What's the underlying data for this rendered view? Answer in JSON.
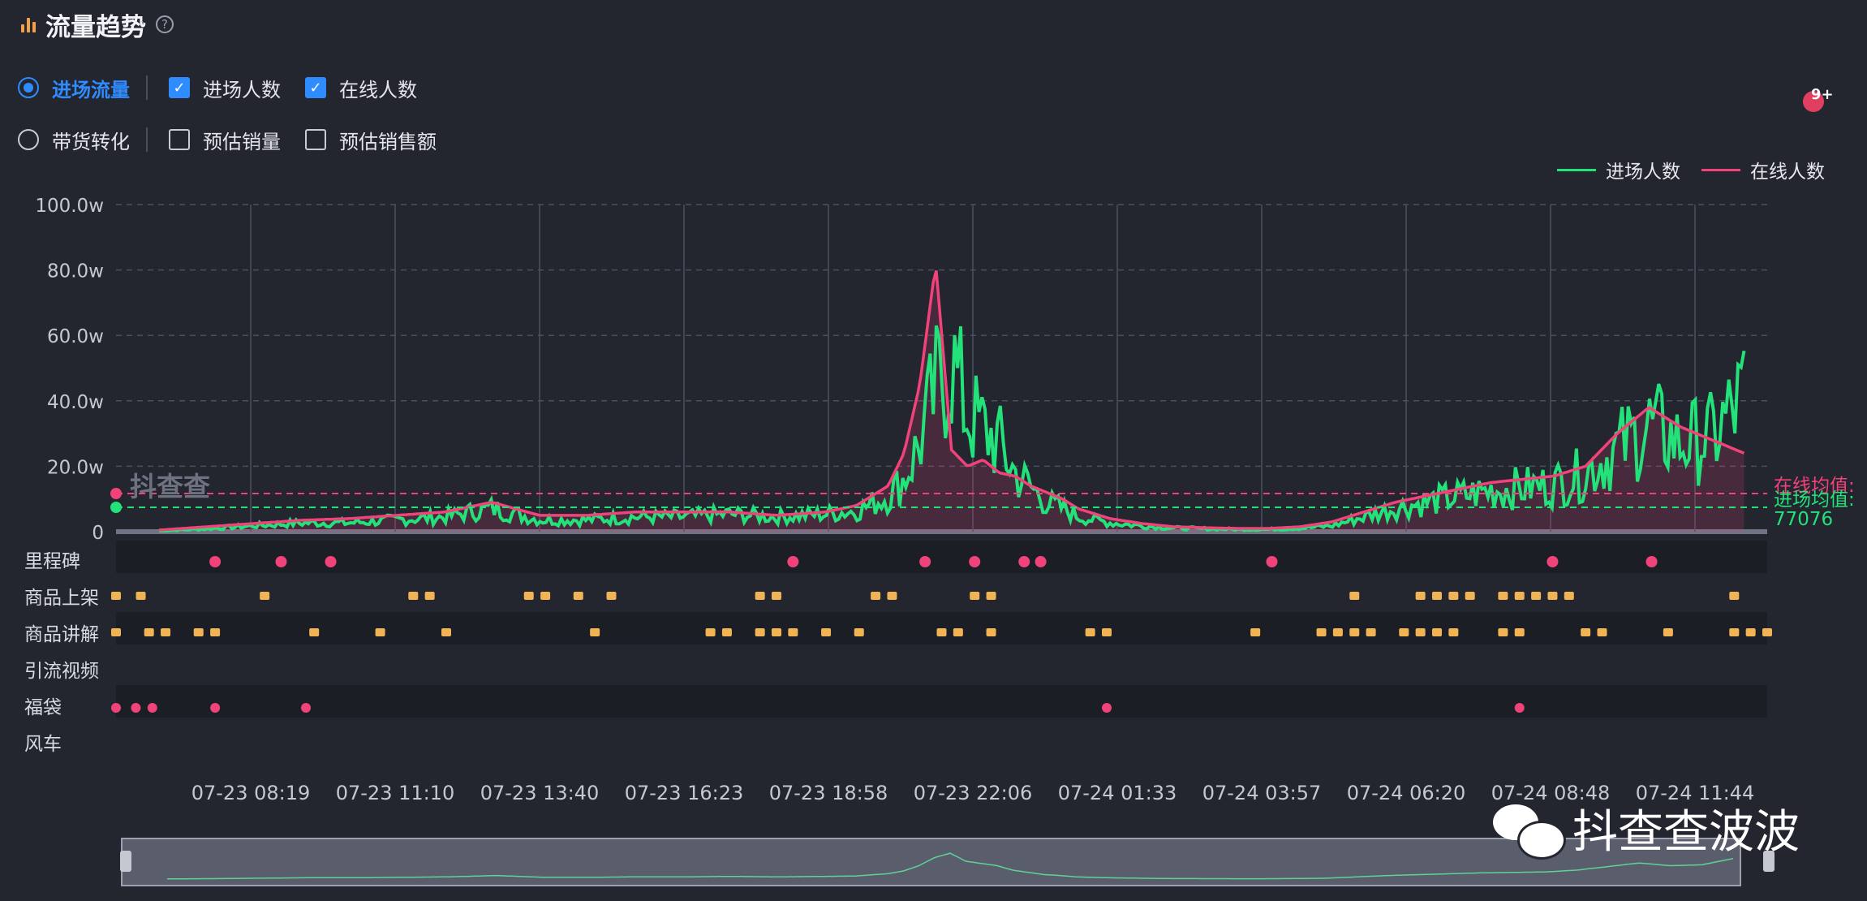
{
  "header": {
    "title": "流量趋势",
    "help_icon": "?"
  },
  "options": {
    "row1": [
      {
        "type": "radio",
        "label": "进场流量",
        "checked": true
      },
      {
        "type": "checkbox",
        "label": "进场人数",
        "checked": true
      },
      {
        "type": "checkbox",
        "label": "在线人数",
        "checked": true
      }
    ],
    "row2": [
      {
        "type": "radio",
        "label": "带货转化",
        "checked": false
      },
      {
        "type": "checkbox",
        "label": "预估销量",
        "checked": false
      },
      {
        "type": "checkbox",
        "label": "预估销售额",
        "checked": false
      }
    ]
  },
  "notification": {
    "badge": "9+",
    "icon": "gift-icon"
  },
  "legend": [
    {
      "name": "进场人数",
      "color": "#23e27a"
    },
    {
      "name": "在线人数",
      "color": "#f0437a"
    }
  ],
  "event_rows": {
    "labels": [
      "里程碑",
      "商品上架",
      "商品讲解",
      "引流视频",
      "福袋",
      "风车"
    ]
  },
  "watermark": "抖查查",
  "brand": "抖查查波波",
  "chart_data": {
    "type": "line",
    "ylabel": "",
    "ylim": [
      0,
      100
    ],
    "y_ticks": [
      "100.0w",
      "80.0w",
      "60.0w",
      "40.0w",
      "20.0w",
      "0"
    ],
    "x_ticks": [
      "07-23 08:19",
      "07-23 11:10",
      "07-23 13:40",
      "07-23 16:23",
      "07-23 18:58",
      "07-23 22:06",
      "07-24 01:33",
      "07-24 03:57",
      "07-24 06:20",
      "07-24 08:48",
      "07-24 11:44"
    ],
    "x": [
      0,
      0.03,
      0.06,
      0.09,
      0.12,
      0.15,
      0.18,
      0.21,
      0.24,
      0.27,
      0.3,
      0.33,
      0.36,
      0.39,
      0.42,
      0.44,
      0.46,
      0.47,
      0.48,
      0.49,
      0.5,
      0.51,
      0.52,
      0.53,
      0.54,
      0.55,
      0.56,
      0.57,
      0.58,
      0.6,
      0.62,
      0.64,
      0.66,
      0.68,
      0.7,
      0.72,
      0.74,
      0.76,
      0.78,
      0.8,
      0.82,
      0.84,
      0.86,
      0.88,
      0.9,
      0.92,
      0.94,
      0.96,
      0.98,
      1.0
    ],
    "series": [
      {
        "name": "在线人数",
        "color": "#f0437a",
        "values": [
          0.5,
          1.5,
          2.5,
          3.5,
          4,
          5,
          6,
          9,
          5,
          5,
          6,
          6,
          6,
          5,
          6,
          8,
          14,
          24,
          45,
          82,
          25,
          20,
          22,
          18,
          17,
          14,
          12,
          10,
          7,
          4,
          2.5,
          1.5,
          1.2,
          1.0,
          1.0,
          1.5,
          3,
          6,
          9,
          11,
          13,
          15,
          16,
          17,
          20,
          30,
          38,
          32,
          28,
          24
        ]
      },
      {
        "name": "进场人数",
        "color": "#23e27a",
        "values": [
          0.3,
          1,
          2,
          3,
          3,
          4,
          5,
          8,
          4,
          4,
          5,
          5,
          6,
          5,
          6,
          7,
          12,
          18,
          30,
          48,
          58,
          40,
          35,
          30,
          20,
          15,
          10,
          8,
          5,
          3,
          2,
          1.2,
          1.0,
          0.8,
          0.8,
          1.2,
          2,
          5,
          8,
          10,
          12,
          14,
          15,
          16,
          20,
          28,
          36,
          30,
          32,
          46
        ]
      }
    ],
    "averages": [
      {
        "label": "在线均值:",
        "value": "",
        "color": "#f0437a"
      },
      {
        "label": "进场均值:",
        "value": "77076",
        "color": "#23e27a"
      }
    ],
    "legend_position": "top-right",
    "grid": true
  }
}
